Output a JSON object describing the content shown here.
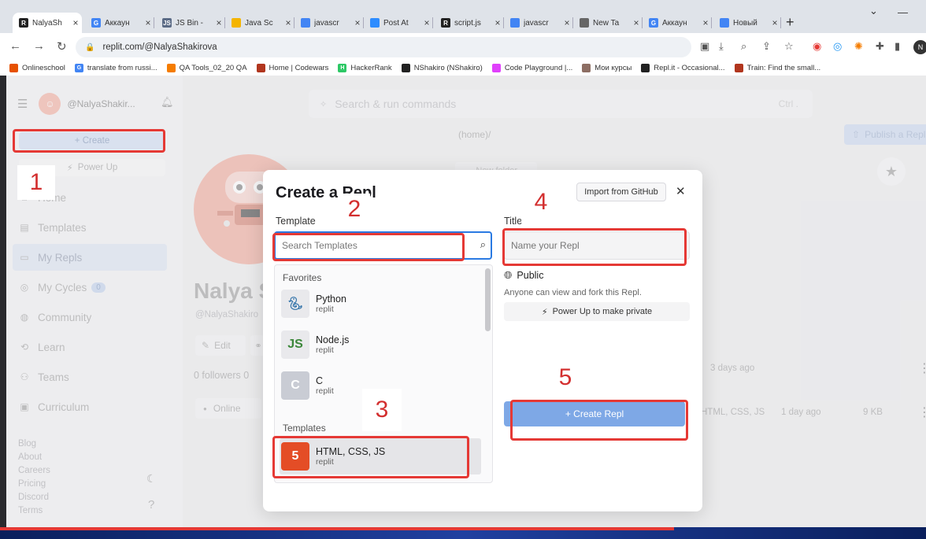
{
  "browser": {
    "tabs": [
      {
        "title": "NalyaSh",
        "icon": "replit-icon",
        "color": "#222222",
        "letter": "R",
        "active": true
      },
      {
        "title": "Аккаун",
        "icon": "google-icon",
        "color": "#4285f4",
        "letter": "G"
      },
      {
        "title": "JS Bin -",
        "icon": "jsbin-icon",
        "color": "#5b6b86",
        "letter": "JS"
      },
      {
        "title": "Java Sc",
        "icon": "slides-icon",
        "color": "#f4b400",
        "letter": ""
      },
      {
        "title": "javascr",
        "icon": "docs-icon",
        "color": "#4285f4",
        "letter": ""
      },
      {
        "title": "Post At",
        "icon": "zoom-icon",
        "color": "#2d8cff",
        "letter": ""
      },
      {
        "title": "script.js",
        "icon": "replit-icon",
        "color": "#222222",
        "letter": "R"
      },
      {
        "title": "javascr",
        "icon": "docs-icon",
        "color": "#4285f4",
        "letter": ""
      },
      {
        "title": "New Ta",
        "icon": "globe-icon",
        "color": "#666666",
        "letter": ""
      },
      {
        "title": "Аккаун",
        "icon": "google-icon",
        "color": "#4285f4",
        "letter": "G"
      },
      {
        "title": "Новый",
        "icon": "docs-icon",
        "color": "#4285f4",
        "letter": ""
      }
    ],
    "url": "replit.com/@NalyaShakirova",
    "profile_letter": "N",
    "bookmarks": [
      {
        "label": "Onlineschool",
        "color": "#e65100",
        "letter": ""
      },
      {
        "label": "translate from russi...",
        "color": "#4285f4",
        "letter": "G"
      },
      {
        "label": "QA Tools_02_20 QA",
        "color": "#f57c00",
        "letter": ""
      },
      {
        "label": "Home | Codewars",
        "color": "#b1361e",
        "letter": ""
      },
      {
        "label": "HackerRank",
        "color": "#2ec866",
        "letter": "H"
      },
      {
        "label": "NShakiro (NShakiro)",
        "color": "#222222",
        "letter": ""
      },
      {
        "label": "Code Playground |...",
        "color": "#e040fb",
        "letter": ""
      },
      {
        "label": "Мои курсы",
        "color": "#8d6e63",
        "letter": ""
      },
      {
        "label": "Repl.it - Occasional...",
        "color": "#222222",
        "letter": ""
      },
      {
        "label": "Train: Find the small...",
        "color": "#b1361e",
        "letter": ""
      }
    ]
  },
  "sidebar": {
    "username": "@NalyaShakir...",
    "create_label": "+ Create",
    "powerup_label": "Power Up",
    "nav": [
      {
        "label": "Home",
        "icon": "home-icon",
        "glyph": "⌂"
      },
      {
        "label": "Templates",
        "icon": "templates-icon",
        "glyph": "▤"
      },
      {
        "label": "My Repls",
        "icon": "folder-icon",
        "glyph": "▭",
        "selected": true
      },
      {
        "label": "My Cycles",
        "icon": "cycles-icon",
        "glyph": "◎",
        "badge": "0"
      },
      {
        "label": "Community",
        "icon": "community-icon",
        "glyph": "◍"
      },
      {
        "label": "Learn",
        "icon": "learn-icon",
        "glyph": "⟲"
      },
      {
        "label": "Teams",
        "icon": "teams-icon",
        "glyph": "⚇"
      },
      {
        "label": "Curriculum",
        "icon": "curriculum-icon",
        "glyph": "▣"
      }
    ],
    "footer": [
      "Blog",
      "About",
      "Careers",
      "Pricing",
      "Discord",
      "Terms"
    ]
  },
  "main": {
    "search_placeholder": "Search & run commands",
    "search_shortcut": "Ctrl .",
    "breadcrumb": "(home)/",
    "publish_label": "Publish a Repl",
    "new_folder_label": "New folder",
    "profile_name": "Nalya S",
    "profile_handle": "@NalyaShakiro",
    "edit_label": "Edit",
    "followers": "0 followers  0",
    "online_label": "Online",
    "rows": [
      {
        "date": "3 days ago"
      },
      {
        "langs": "HTML, CSS, JS",
        "date": "1 day ago",
        "size": "9 KB"
      }
    ]
  },
  "modal": {
    "title": "Create a Repl",
    "import_label": "Import from GitHub",
    "template_label": "Template",
    "search_placeholder": "Search Templates",
    "favorites_label": "Favorites",
    "favorites": [
      {
        "name": "Python",
        "owner": "replit",
        "icon": "python-icon"
      },
      {
        "name": "Node.js",
        "owner": "replit",
        "icon": "nodejs-icon"
      },
      {
        "name": "C",
        "owner": "replit",
        "icon": "c-lang-icon"
      }
    ],
    "templates_label": "Templates",
    "templates": [
      {
        "name": "HTML, CSS, JS",
        "owner": "replit",
        "icon": "html5-icon"
      }
    ],
    "title_label": "Title",
    "title_placeholder": "Name your Repl",
    "public_label": "Public",
    "public_desc": "Anyone can view and fork this Repl.",
    "make_private_label": "Power Up to make private",
    "create_label": "+ Create Repl"
  },
  "annotations": [
    "1",
    "2",
    "3",
    "4",
    "5"
  ]
}
